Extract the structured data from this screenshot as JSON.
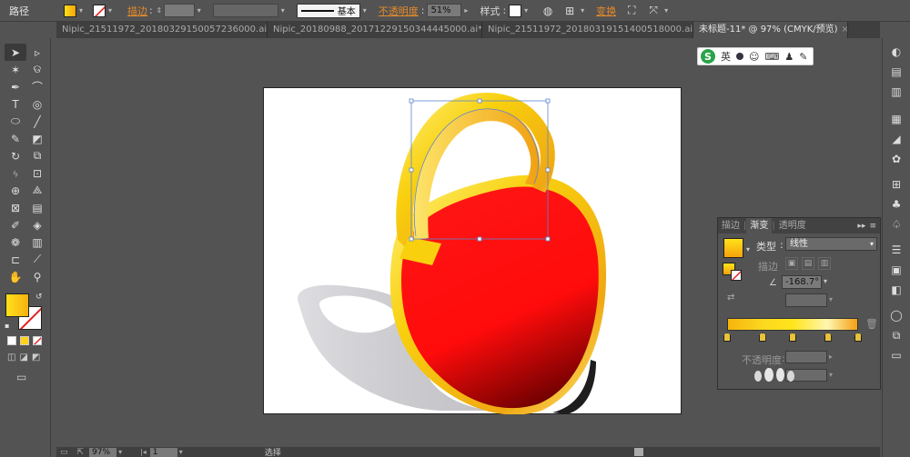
{
  "control_bar": {
    "mode_label": "路径",
    "stroke_label": "描边",
    "stroke_style_label": "基本",
    "opacity_label": "不透明度",
    "opacity_value": "51%",
    "style_label": "样式",
    "transform_label": "变换"
  },
  "tabs": [
    {
      "label": "Nipic_21511972_20180329150057236000.ai*",
      "active": false
    },
    {
      "label": "Nipic_20180988_20171229150344445000.ai*",
      "active": false
    },
    {
      "label": "Nipic_21511972_20180319151400518000.ai*",
      "active": false
    },
    {
      "label": "未标题-11* @ 97% (CMYK/预览)",
      "active": true
    }
  ],
  "ime_toolbar": {
    "label": "英"
  },
  "gradient_panel": {
    "tabs": [
      "描边",
      "渐变",
      "透明度"
    ],
    "type_label": "类型",
    "type_value": "线性",
    "stroke_label": "描边",
    "angle_value": "-168.7°",
    "opacity_label": "不透明度",
    "stops": [
      0,
      0.27,
      0.5,
      0.77,
      1.0
    ]
  },
  "status_bar": {
    "zoom": "97%",
    "page": "1",
    "tool": "选择"
  },
  "colors": {
    "fill_yellow": "#fbe21a",
    "red": "#ff1111"
  }
}
